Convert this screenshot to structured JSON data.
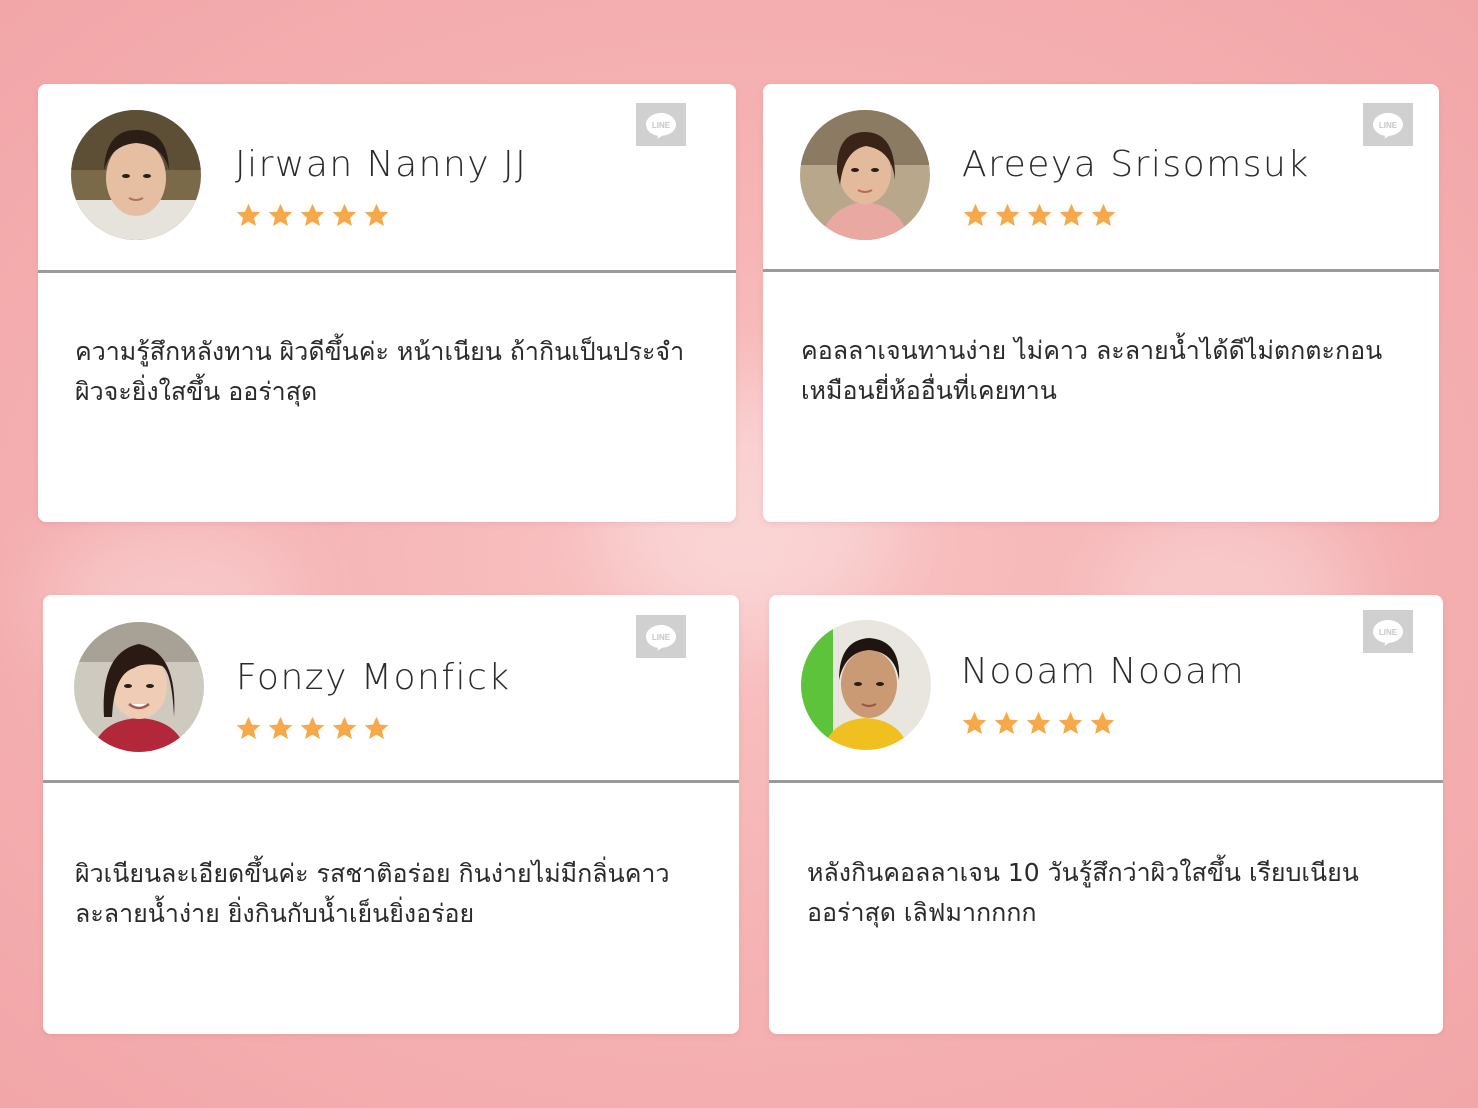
{
  "reviews": [
    {
      "name": "Jirwan Nanny JJ",
      "rating": 5,
      "badge": "LINE",
      "text_line1": "ความรู้สึกหลังทาน ผิวดีขึ้นค่ะ หน้าเนียน ถ้ากินเป็นประจำ",
      "text_line2": "ผิวจะยิ่งใสขึ้น ออร่าสุด"
    },
    {
      "name": "Areeya Srisomsuk",
      "rating": 5,
      "badge": "LINE",
      "text_line1": "คอลลาเจนทานง่าย ไม่คาว ละลายน้ำได้ดีไม่ตกตะกอน",
      "text_line2": "เหมือนยี่ห้ออื่นที่เคยทาน"
    },
    {
      "name": "Fonzy Monfick",
      "rating": 5,
      "badge": "LINE",
      "text_line1": "ผิวเนียนละเอียดขึ้นค่ะ รสชาติอร่อย กินง่ายไม่มีกลิ่นคาว",
      "text_line2": "ละลายน้ำง่าย ยิ่งกินกับน้ำเย็นยิ่งอร่อย"
    },
    {
      "name": "Nooam Nooam",
      "rating": 5,
      "badge": "LINE",
      "text_line1": "หลังกินคอลลาเจน 10 วันรู้สึกว่าผิวใสขึ้น เรียบเนียน",
      "text_line2": "ออร่าสุด เลิฟมากกกก"
    }
  ],
  "colors": {
    "star": "#f7a94a",
    "badge": "#d0d0d0",
    "divider": "#9a9a9a",
    "background": "#f6b4b5"
  },
  "icons": {
    "badge": "line-icon",
    "rating": "star-icon"
  }
}
